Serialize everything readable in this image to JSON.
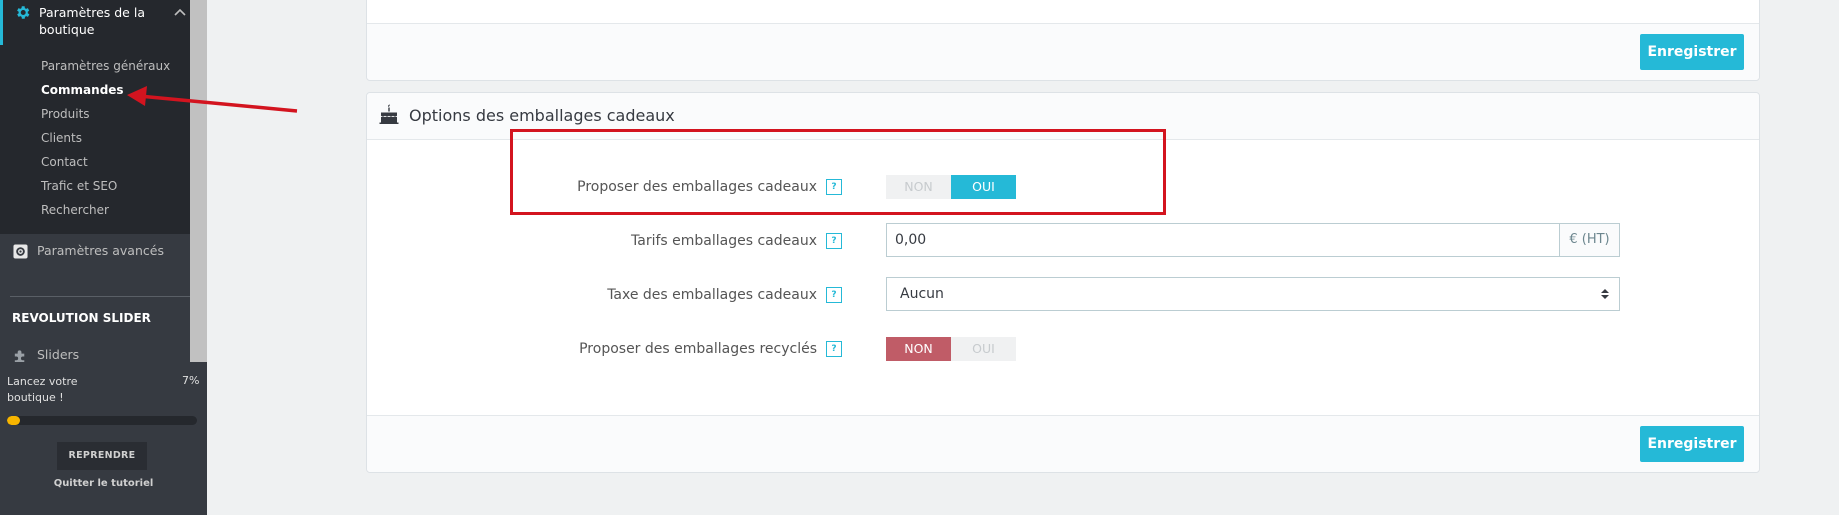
{
  "sidebar": {
    "active_section": {
      "label": "Paramètres de la boutique",
      "icon": "gear-icon"
    },
    "sub_items": [
      {
        "label": "Paramètres généraux",
        "active": false
      },
      {
        "label": "Commandes",
        "active": true
      },
      {
        "label": "Produits",
        "active": false
      },
      {
        "label": "Clients",
        "active": false
      },
      {
        "label": "Contact",
        "active": false
      },
      {
        "label": "Trafic et SEO",
        "active": false
      },
      {
        "label": "Rechercher",
        "active": false
      }
    ],
    "advanced": {
      "label": "Paramètres avancés",
      "icon": "settings-box-icon"
    },
    "group_title": "REVOLUTION SLIDER",
    "sliders": {
      "label": "Sliders",
      "icon": "puzzle-icon"
    }
  },
  "tutorial": {
    "text": "Lancez votre boutique !",
    "percent_label": "7%",
    "progress": 0.07,
    "resume_button": "REPRENDRE",
    "quit_link": "Quitter le tutoriel"
  },
  "top_panel": {
    "save_label": "Enregistrer"
  },
  "gift_panel": {
    "title": "Options des emballages cadeaux",
    "icon": "cake-icon",
    "save_label": "Enregistrer",
    "fields": {
      "offer_gift": {
        "label": "Proposer des emballages cadeaux",
        "help": "?",
        "off_label": "NON",
        "on_label": "OUI",
        "value": "OUI"
      },
      "gift_price": {
        "label": "Tarifs emballages cadeaux",
        "help": "?",
        "value": "0,00",
        "addon": "€ (HT)"
      },
      "gift_tax": {
        "label": "Taxe des emballages cadeaux",
        "help": "?",
        "value": "Aucun"
      },
      "recycled": {
        "label": "Proposer des emballages recyclés",
        "help": "?",
        "off_label": "NON",
        "on_label": "OUI",
        "value": "NON"
      }
    }
  },
  "colors": {
    "accent": "#25b9d7",
    "danger": "#c05c67",
    "sidebar_bg": "#363a41",
    "annotation_red": "#d3141f"
  }
}
